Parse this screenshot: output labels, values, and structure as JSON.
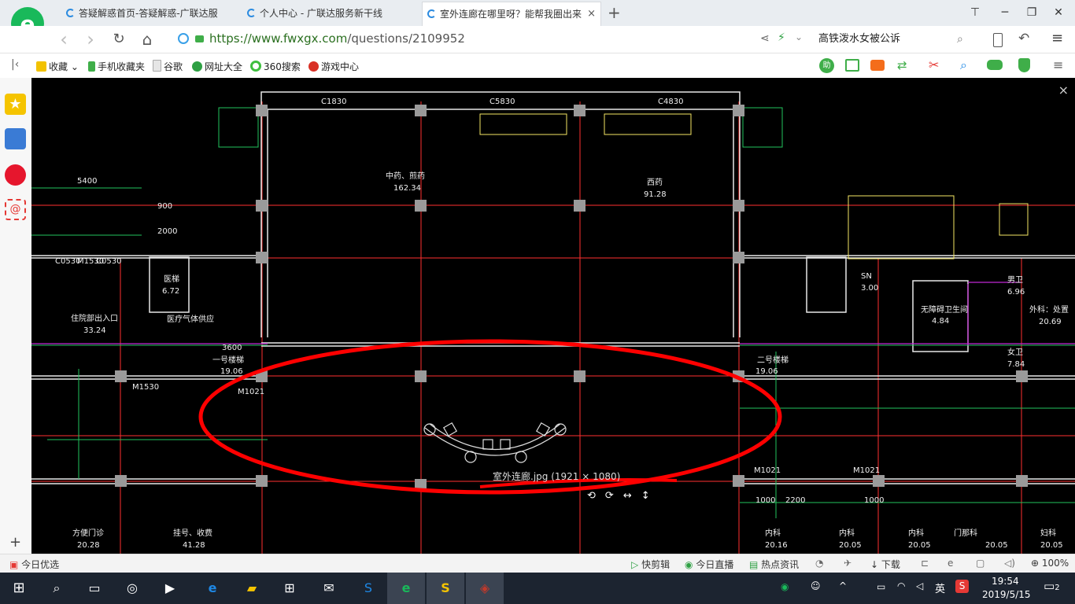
{
  "browser": {
    "tabs": [
      {
        "title": "答疑解惑首页-答疑解惑-广联达服"
      },
      {
        "title": "个人中心 - 广联达服务新干线"
      },
      {
        "title": "室外连廊在哪里呀？能帮我圈出来"
      }
    ],
    "new_tab_symbol": "+",
    "tab_close_symbol": "×",
    "url_host": "https://www.fwxgx.com",
    "url_path": "/questions/2109952",
    "search_text": "高铁泼水女被公诉",
    "nav": {
      "back": "‹",
      "forward": "›",
      "refresh": "↻",
      "home": "⌂"
    }
  },
  "bookmarks": [
    {
      "label": "收藏",
      "color": "#f2c200"
    },
    {
      "label": "手机收藏夹",
      "color": "#3fae49"
    },
    {
      "label": "谷歌",
      "color": "#9aa0a6"
    },
    {
      "label": "网址大全",
      "color": "#2ea043"
    },
    {
      "label": "360搜索",
      "color": "#3fbf3f"
    },
    {
      "label": "游戏中心",
      "color": "#d93025"
    }
  ],
  "viewer": {
    "caption": "室外连廊.jpg (1921 × 1080)",
    "close_symbol": "×",
    "toolbar_symbols": [
      "⟲",
      "⟳",
      "↔",
      "↕"
    ],
    "drawing_labels": [
      {
        "text": "C1830"
      },
      {
        "text": "C5830"
      },
      {
        "text": "C4830"
      },
      {
        "text": "中药、煎药"
      },
      {
        "text": "162.34"
      },
      {
        "text": "西药"
      },
      {
        "text": "91.28"
      },
      {
        "text": "5400"
      },
      {
        "text": "900"
      },
      {
        "text": "2000"
      },
      {
        "text": "C0530"
      },
      {
        "text": "M1530"
      },
      {
        "text": "C0530"
      },
      {
        "text": "医梯"
      },
      {
        "text": "6.72"
      },
      {
        "text": "住院部出入口"
      },
      {
        "text": "33.24"
      },
      {
        "text": "医疗气体供应"
      },
      {
        "text": "3600"
      },
      {
        "text": "一号楼梯"
      },
      {
        "text": "19.06"
      },
      {
        "text": "M1021"
      },
      {
        "text": "M1530"
      },
      {
        "text": "二号楼梯"
      },
      {
        "text": "19.06"
      },
      {
        "text": "SN"
      },
      {
        "text": "3.00"
      },
      {
        "text": "男卫"
      },
      {
        "text": "6.96"
      },
      {
        "text": "女卫"
      },
      {
        "text": "7.84"
      },
      {
        "text": "外科：处置"
      },
      {
        "text": "20.69"
      },
      {
        "text": "无障碍卫生间"
      },
      {
        "text": "4.84"
      },
      {
        "text": "方便门诊"
      },
      {
        "text": "20.28"
      },
      {
        "text": "挂号、收费"
      },
      {
        "text": "41.28"
      },
      {
        "text": "内科"
      },
      {
        "text": "20.16"
      },
      {
        "text": "内科"
      },
      {
        "text": "20.05"
      },
      {
        "text": "内科"
      },
      {
        "text": "20.05"
      },
      {
        "text": "门那科"
      },
      {
        "text": "20.05"
      },
      {
        "text": "妇科"
      },
      {
        "text": "20.05"
      },
      {
        "text": "M1021"
      },
      {
        "text": "M1021"
      },
      {
        "text": "1000"
      },
      {
        "text": "2200"
      },
      {
        "text": "1000"
      }
    ]
  },
  "status_bar": {
    "left": "今日优选",
    "items": [
      "快剪辑",
      "今日直播",
      "热点资讯",
      "下载"
    ],
    "zoom": "100%"
  },
  "taskbar": {
    "time": "19:54",
    "date": "2019/5/15",
    "ime": "英",
    "notification_count": "2"
  },
  "colors": {
    "annotation": "#ff0000",
    "cad_red": "#ff3030",
    "cad_white": "#e8e8e8",
    "cad_green": "#22c55e",
    "cad_magenta": "#c026d3",
    "cad_yellow": "#f5e663"
  }
}
